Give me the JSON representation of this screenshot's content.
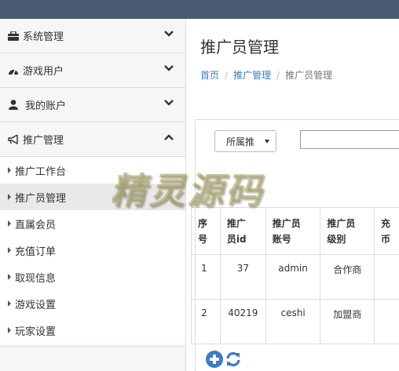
{
  "sidebar": {
    "groups": [
      {
        "label": "系统管理",
        "icon": "briefcase-icon"
      },
      {
        "label": "游戏用户",
        "icon": "dashboard-icon"
      },
      {
        "label": "我的账户",
        "icon": "user-icon"
      },
      {
        "label": "推广管理",
        "icon": "bullhorn-icon"
      }
    ],
    "sub_items": [
      "推广工作台",
      "推广员管理",
      "直属会员",
      "充值订单",
      "取现信息",
      "游戏设置",
      "玩家设置"
    ],
    "active_sub_item": "推广员管理"
  },
  "main": {
    "title": "推广员管理",
    "breadcrumb": [
      "首页",
      "推广管理",
      "推广员管理"
    ],
    "filter": {
      "select_value": "所属推",
      "search_value": ""
    },
    "table": {
      "columns": [
        "序号",
        "推广员id",
        "推广员账号",
        "推广员级别",
        "充值币"
      ],
      "columns_display": [
        [
          "序",
          "号"
        ],
        [
          "推广",
          "员id"
        ],
        [
          "推广员",
          "账号"
        ],
        [
          "推广员",
          "级别"
        ],
        [
          "充",
          "币"
        ]
      ],
      "rows": [
        {
          "index": "1",
          "id": "37",
          "account": "admin",
          "level": "合作商"
        },
        {
          "index": "2",
          "id": "40219",
          "account": "ceshi",
          "level": "加盟商"
        }
      ]
    },
    "toolbar": {
      "add_icon": "plus-circle-icon",
      "refresh_icon": "refresh-icon"
    }
  },
  "watermark": "精灵源码",
  "colors": {
    "topbar": "#4a5a73",
    "link": "#3a7cc7",
    "active_bg": "#e9e9e9"
  }
}
